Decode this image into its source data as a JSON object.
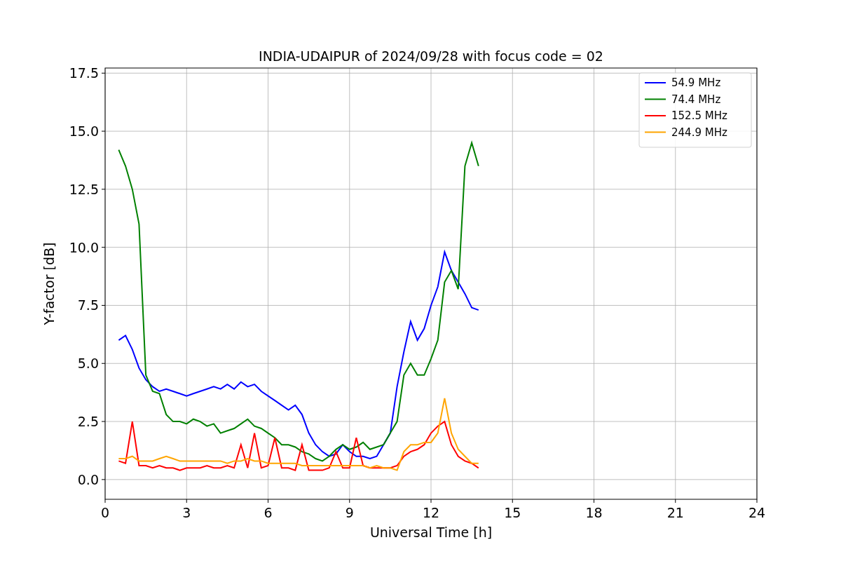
{
  "chart_data": {
    "type": "line",
    "title": "INDIA-UDAIPUR of 2024/09/28 with focus code = 02",
    "xlabel": "Universal Time [h]",
    "ylabel": "Y-factor [dB]",
    "x": [
      0.5,
      0.75,
      1.0,
      1.25,
      1.5,
      1.75,
      2.0,
      2.25,
      2.5,
      2.75,
      3.0,
      3.25,
      3.5,
      3.75,
      4.0,
      4.25,
      4.5,
      4.75,
      5.0,
      5.25,
      5.5,
      5.75,
      6.0,
      6.25,
      6.5,
      6.75,
      7.0,
      7.25,
      7.5,
      7.75,
      8.0,
      8.25,
      8.5,
      8.75,
      9.0,
      9.25,
      9.5,
      9.75,
      10.0,
      10.25,
      10.5,
      10.75,
      11.0,
      11.25,
      11.5,
      11.75,
      12.0,
      12.25,
      12.5,
      12.75,
      13.0,
      13.25,
      13.5,
      13.75
    ],
    "series": [
      {
        "name": "54.9 MHz",
        "color": "#0000ff",
        "values": [
          6.0,
          6.2,
          5.6,
          4.8,
          4.3,
          4.0,
          3.8,
          3.9,
          3.8,
          3.7,
          3.6,
          3.7,
          3.8,
          3.9,
          4.0,
          3.9,
          4.1,
          3.9,
          4.2,
          4.0,
          4.1,
          3.8,
          3.6,
          3.4,
          3.2,
          3.0,
          3.2,
          2.8,
          2.0,
          1.5,
          1.2,
          1.0,
          1.1,
          1.5,
          1.2,
          1.0,
          1.0,
          0.9,
          1.0,
          1.5,
          2.0,
          4.0,
          5.5,
          6.8,
          6.0,
          6.5,
          7.5,
          8.3,
          9.8,
          9.0,
          8.5,
          8.0,
          7.4,
          7.3
        ]
      },
      {
        "name": "74.4 MHz",
        "color": "#008000",
        "values": [
          14.2,
          13.5,
          12.5,
          11.0,
          4.5,
          3.8,
          3.7,
          2.8,
          2.5,
          2.5,
          2.4,
          2.6,
          2.5,
          2.3,
          2.4,
          2.0,
          2.1,
          2.2,
          2.4,
          2.6,
          2.3,
          2.2,
          2.0,
          1.8,
          1.5,
          1.5,
          1.4,
          1.2,
          1.1,
          0.9,
          0.8,
          1.0,
          1.3,
          1.5,
          1.3,
          1.4,
          1.6,
          1.3,
          1.4,
          1.5,
          2.0,
          2.5,
          4.5,
          5.0,
          4.5,
          4.5,
          5.2,
          6.0,
          8.5,
          9.0,
          8.2,
          13.5,
          14.5,
          13.5
        ]
      },
      {
        "name": "152.5 MHz",
        "color": "#ff0000",
        "values": [
          0.8,
          0.7,
          2.5,
          0.6,
          0.6,
          0.5,
          0.6,
          0.5,
          0.5,
          0.4,
          0.5,
          0.5,
          0.5,
          0.6,
          0.5,
          0.5,
          0.6,
          0.5,
          1.5,
          0.5,
          2.0,
          0.5,
          0.6,
          1.8,
          0.5,
          0.5,
          0.4,
          1.5,
          0.4,
          0.4,
          0.4,
          0.5,
          1.2,
          0.5,
          0.5,
          1.8,
          0.6,
          0.5,
          0.5,
          0.5,
          0.5,
          0.6,
          1.0,
          1.2,
          1.3,
          1.5,
          2.0,
          2.3,
          2.5,
          1.5,
          1.0,
          0.8,
          0.7,
          0.5
        ]
      },
      {
        "name": "244.9 MHz",
        "color": "#ffa500",
        "values": [
          0.9,
          0.9,
          1.0,
          0.8,
          0.8,
          0.8,
          0.9,
          1.0,
          0.9,
          0.8,
          0.8,
          0.8,
          0.8,
          0.8,
          0.8,
          0.8,
          0.7,
          0.8,
          0.8,
          0.9,
          0.8,
          0.8,
          0.7,
          0.7,
          0.7,
          0.7,
          0.7,
          0.6,
          0.6,
          0.6,
          0.6,
          0.6,
          0.6,
          0.6,
          0.6,
          0.6,
          0.6,
          0.5,
          0.6,
          0.5,
          0.5,
          0.4,
          1.2,
          1.5,
          1.5,
          1.6,
          1.6,
          2.0,
          3.5,
          2.0,
          1.3,
          1.0,
          0.7,
          0.7
        ]
      }
    ],
    "grid": true,
    "legend": true,
    "xlim": [
      0,
      24
    ],
    "ylim": [
      -0.85,
      17.72
    ],
    "xticks": [
      0,
      3,
      6,
      9,
      12,
      15,
      18,
      21,
      24
    ],
    "yticks": [
      {
        "value": 0,
        "label": "0.0"
      },
      {
        "value": 2.5,
        "label": "2.5"
      },
      {
        "value": 5,
        "label": "5.0"
      },
      {
        "value": 7.5,
        "label": "7.5"
      },
      {
        "value": 10,
        "label": "10.0"
      },
      {
        "value": 12.5,
        "label": "12.5"
      },
      {
        "value": 15,
        "label": "15.0"
      },
      {
        "value": 17.5,
        "label": "17.5"
      }
    ]
  }
}
